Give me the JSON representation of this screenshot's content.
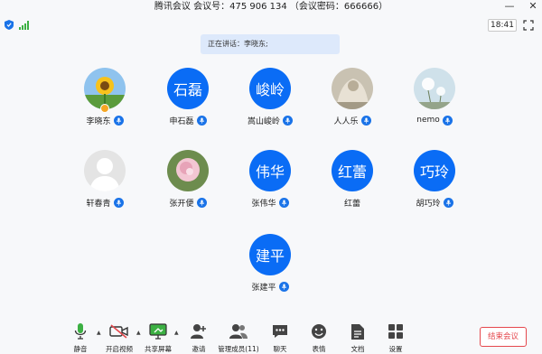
{
  "titlebar": {
    "title": "腾讯会议 会议号：475 906 134 （会议密码：666666）"
  },
  "status": {
    "clock": "18:41"
  },
  "speaking": {
    "text": "正在讲话：李晓东;"
  },
  "participants": [
    {
      "name": "李晓东",
      "avatar_type": "sunflower-photo",
      "host": true
    },
    {
      "name": "申石磊",
      "avatar_type": "initials",
      "initials": "石磊"
    },
    {
      "name": "嵩山峻岭",
      "avatar_type": "initials",
      "initials": "峻岭"
    },
    {
      "name": "人人乐",
      "avatar_type": "sculpture-photo"
    },
    {
      "name": "nemo",
      "avatar_type": "dandelion-photo"
    },
    {
      "name": "轩春青",
      "avatar_type": "default-person"
    },
    {
      "name": "张开便",
      "avatar_type": "peony-photo"
    },
    {
      "name": "张伟华",
      "avatar_type": "initials",
      "initials": "伟华"
    },
    {
      "name": "红蕾",
      "avatar_type": "initials",
      "initials": "红蕾",
      "muted_icon": false
    },
    {
      "name": "胡巧玲",
      "avatar_type": "initials",
      "initials": "巧玲"
    },
    {
      "name": "张建平",
      "avatar_type": "initials",
      "initials": "建平"
    }
  ],
  "toolbar": {
    "mute": "静音",
    "video": "开启视频",
    "share": "共享屏幕",
    "invite": "邀请",
    "members": "管理成员(11)",
    "chat": "聊天",
    "emoji": "表情",
    "docs": "文档",
    "settings": "设置",
    "end": "结束会议"
  },
  "colors": {
    "accent": "#0a6cf5",
    "end": "#e5484d",
    "banner": "#dde9fb"
  }
}
